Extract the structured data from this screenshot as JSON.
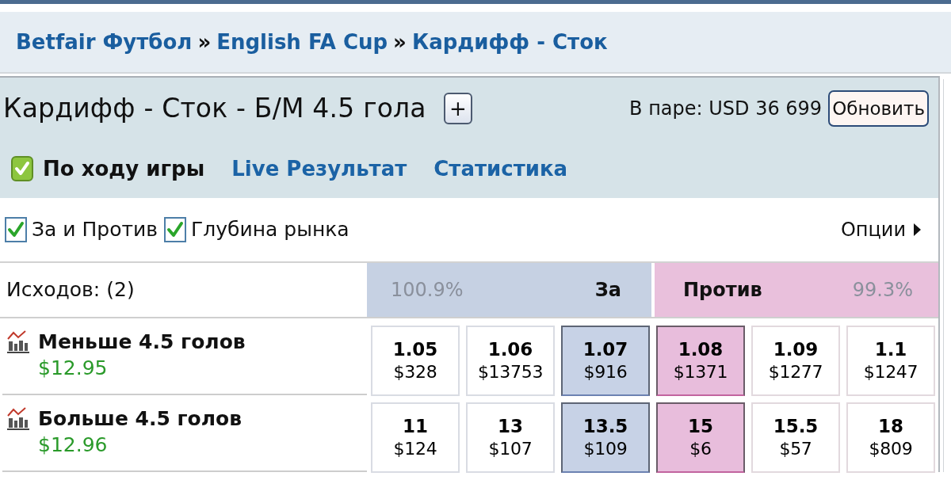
{
  "breadcrumb": [
    {
      "kind": "link",
      "text": "Betfair Футбол"
    },
    {
      "kind": "separator",
      "text": "»"
    },
    {
      "kind": "link",
      "text": "English FA Cup"
    },
    {
      "kind": "separator",
      "text": "»"
    },
    {
      "kind": "link",
      "text": "Кардифф - Сток"
    }
  ],
  "market": {
    "title": "Кардифф - Сток - Б/М 4.5 гола",
    "add_button": "+",
    "matched": "В паре: USD 36 699",
    "refresh_button": "Обновить"
  },
  "in_play": {
    "checked": true,
    "label": "По ходу игры"
  },
  "links": [
    "Live Результат",
    "Статистика"
  ],
  "view_options": [
    {
      "label": "За и Против",
      "checked": true
    },
    {
      "label": "Глубина рынка",
      "checked": true
    }
  ],
  "options_menu": "Опции",
  "table": {
    "outcomes_label": "Исходов: (2)",
    "columns": [
      {
        "kind": "back",
        "percent": "100.9%",
        "label": "За"
      },
      {
        "kind": "lay",
        "label": "Против",
        "percent": "99.3%"
      }
    ],
    "runners": [
      {
        "name": "Меньше 4.5 голов",
        "profit": "$12.95",
        "prices": [
          {
            "kind": "back",
            "best": false,
            "odds": "1.05",
            "amount": "$328"
          },
          {
            "kind": "back",
            "best": false,
            "odds": "1.06",
            "amount": "$13753"
          },
          {
            "kind": "back",
            "best": true,
            "odds": "1.07",
            "amount": "$916"
          },
          {
            "kind": "lay",
            "best": true,
            "odds": "1.08",
            "amount": "$1371"
          },
          {
            "kind": "lay",
            "best": false,
            "odds": "1.09",
            "amount": "$1277"
          },
          {
            "kind": "lay",
            "best": false,
            "odds": "1.1",
            "amount": "$1247"
          }
        ]
      },
      {
        "name": "Больше 4.5 голов",
        "profit": "$12.96",
        "prices": [
          {
            "kind": "back",
            "best": false,
            "odds": "11",
            "amount": "$124"
          },
          {
            "kind": "back",
            "best": false,
            "odds": "13",
            "amount": "$107"
          },
          {
            "kind": "back",
            "best": true,
            "odds": "13.5",
            "amount": "$109"
          },
          {
            "kind": "lay",
            "best": true,
            "odds": "15",
            "amount": "$6"
          },
          {
            "kind": "lay",
            "best": false,
            "odds": "15.5",
            "amount": "$57"
          },
          {
            "kind": "lay",
            "best": false,
            "odds": "18",
            "amount": "$809"
          }
        ]
      }
    ]
  }
}
